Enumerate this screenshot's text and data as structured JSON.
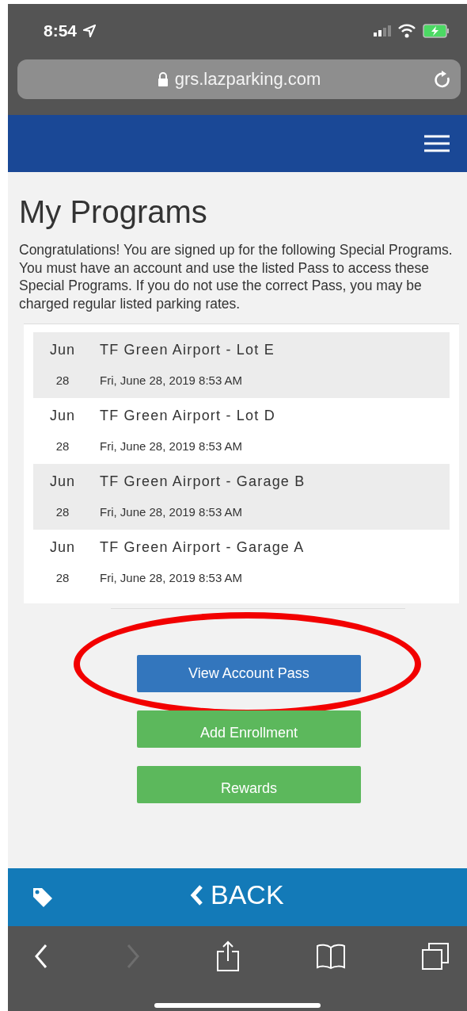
{
  "status_bar": {
    "time": "8:54"
  },
  "address_bar": {
    "url": "grs.lazparking.com"
  },
  "page": {
    "title": "My Programs",
    "intro": "Congratulations! You are signed up for the following Special Programs. You must have an account and use the listed Pass to access these Special Programs. If you do not use the correct Pass, you may be charged regular listed parking rates.",
    "programs": [
      {
        "month": "Jun",
        "day": "28",
        "name": "TF Green Airport - Lot E",
        "datetime": "Fri, June 28, 2019 8:53 AM"
      },
      {
        "month": "Jun",
        "day": "28",
        "name": "TF Green Airport - Lot D",
        "datetime": "Fri, June 28, 2019 8:53 AM"
      },
      {
        "month": "Jun",
        "day": "28",
        "name": "TF Green Airport - Garage B",
        "datetime": "Fri, June 28, 2019 8:53 AM"
      },
      {
        "month": "Jun",
        "day": "28",
        "name": "TF Green Airport - Garage A",
        "datetime": "Fri, June 28, 2019 8:53 AM"
      }
    ],
    "buttons": [
      {
        "label": "View Account Pass",
        "kind": "primary",
        "highlighted": true
      },
      {
        "label": "Add Enrollment",
        "kind": "success",
        "highlighted": false
      },
      {
        "label": "Rewards",
        "kind": "success",
        "highlighted": false
      }
    ]
  },
  "footer": {
    "back_label": "BACK"
  },
  "browser_toolbar": [
    {
      "kind": "back",
      "disabled": false
    },
    {
      "kind": "forward",
      "disabled": true
    },
    {
      "kind": "share",
      "disabled": false
    },
    {
      "kind": "bookmarks",
      "disabled": false
    },
    {
      "kind": "tabs",
      "disabled": false
    }
  ]
}
